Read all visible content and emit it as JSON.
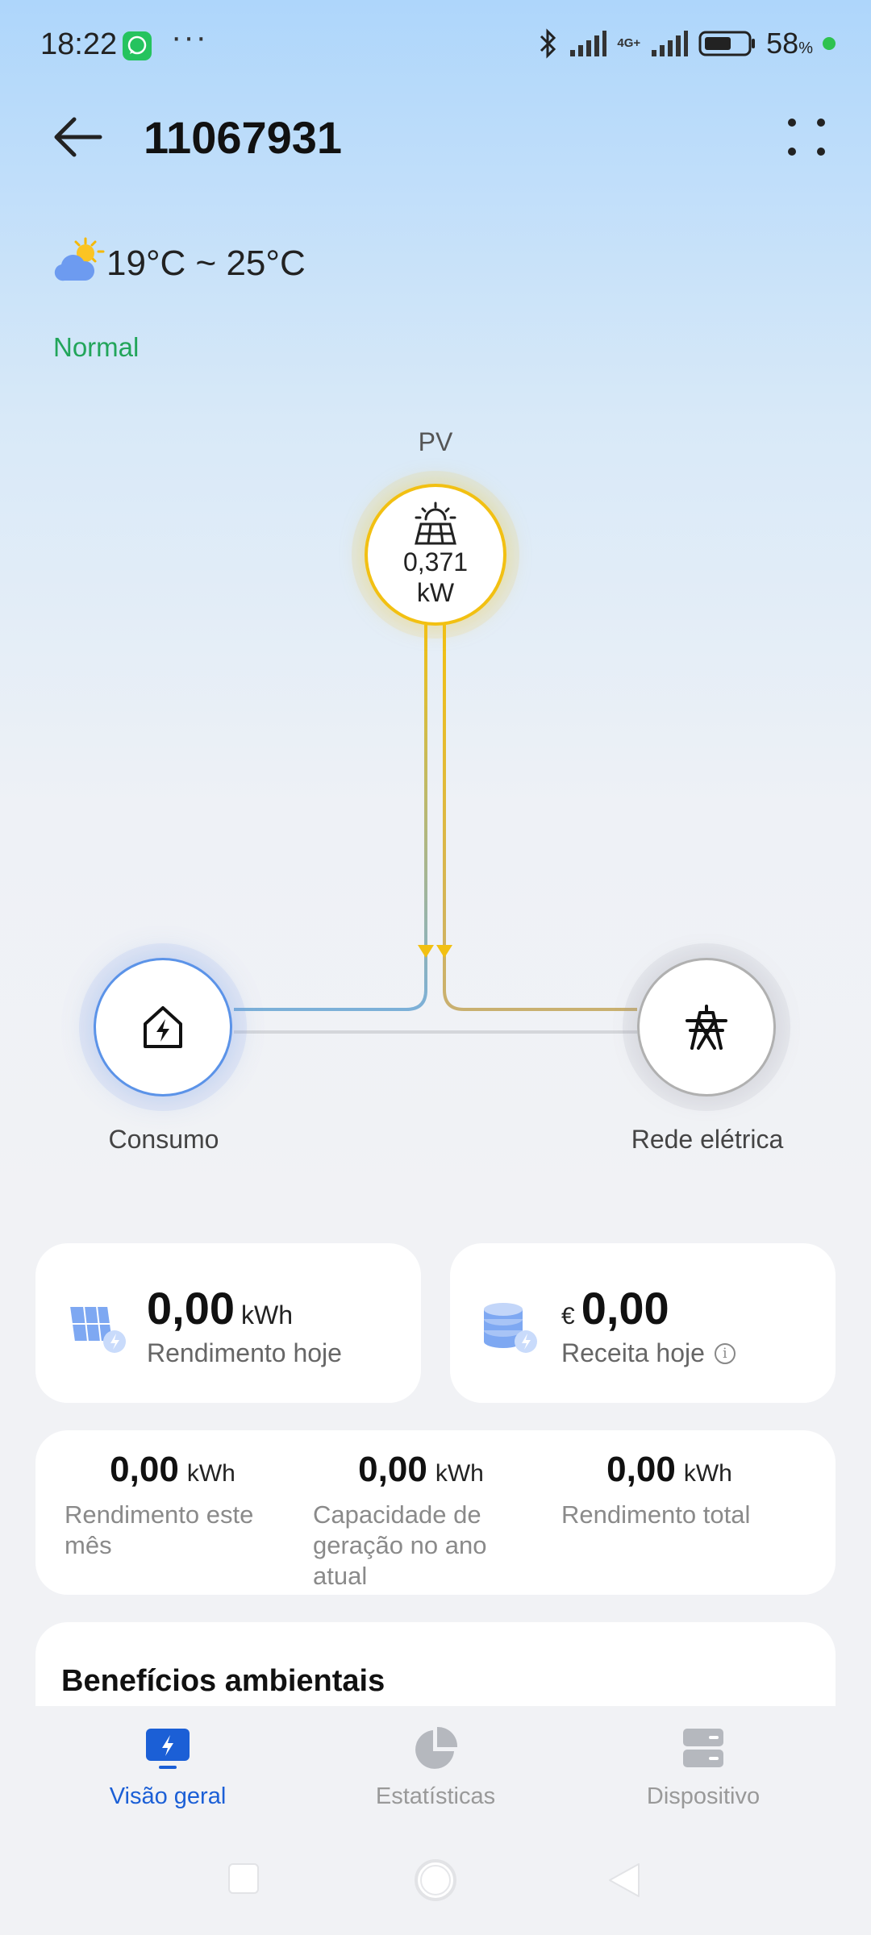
{
  "status_bar": {
    "time": "18:22",
    "dots": "···",
    "network": "4G+",
    "battery_percent": "58",
    "battery_suffix": "%"
  },
  "header": {
    "title": "11067931"
  },
  "weather": {
    "range": "19°C ~ 25°C",
    "icon": "partly-cloudy-icon"
  },
  "plant_status": "Normal",
  "flow": {
    "pv": {
      "label": "PV",
      "value": "0,371",
      "unit": "kW"
    },
    "consumption": {
      "label": "Consumo"
    },
    "grid": {
      "label": "Rede elétrica"
    },
    "colors": {
      "pv": "#f2c012",
      "consumption": "#5b93e8",
      "grid": "#b0b0b0"
    }
  },
  "yield_today": {
    "value": "0,00",
    "unit": "kWh",
    "label": "Rendimento hoje"
  },
  "revenue_today": {
    "currency": "€",
    "value": "0,00",
    "label": "Receita hoje",
    "info": "i"
  },
  "stats": [
    {
      "value": "0,00",
      "unit": "kWh",
      "label": "Rendimento este mês"
    },
    {
      "value": "0,00",
      "unit": "kWh",
      "label": "Capacidade de geração no ano atual"
    },
    {
      "value": "0,00",
      "unit": "kWh",
      "label": "Rendimento total"
    }
  ],
  "environmental": {
    "title": "Benefícios ambientais"
  },
  "nav": {
    "items": [
      {
        "label": "Visão geral",
        "icon": "overview-icon",
        "active": true
      },
      {
        "label": "Estatísticas",
        "icon": "pie-chart-icon",
        "active": false
      },
      {
        "label": "Dispositivo",
        "icon": "device-icon",
        "active": false
      }
    ],
    "active_color": "#1b5fd6"
  }
}
